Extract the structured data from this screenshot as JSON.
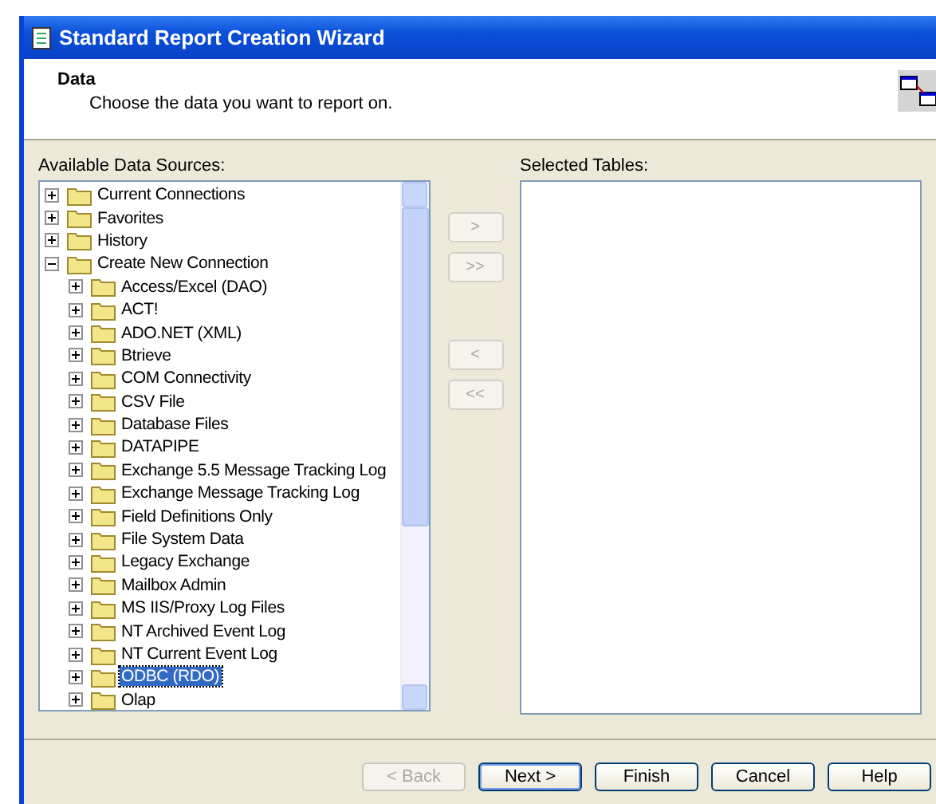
{
  "window": {
    "title": "Standard Report Creation Wizard"
  },
  "header": {
    "title": "Data",
    "subtitle": "Choose the data you want to report on."
  },
  "available": {
    "label": "Available Data Sources:",
    "items": [
      {
        "label": "Current Connections",
        "expanded": false,
        "selected": false
      },
      {
        "label": "Favorites",
        "expanded": false,
        "selected": false
      },
      {
        "label": "History",
        "expanded": false,
        "selected": false
      },
      {
        "label": "Create New Connection",
        "expanded": true,
        "selected": false,
        "children": [
          {
            "label": "Access/Excel (DAO)",
            "expanded": false,
            "selected": false
          },
          {
            "label": "ACT!",
            "expanded": false,
            "selected": false
          },
          {
            "label": "ADO.NET (XML)",
            "expanded": false,
            "selected": false
          },
          {
            "label": "Btrieve",
            "expanded": false,
            "selected": false
          },
          {
            "label": "COM Connectivity",
            "expanded": false,
            "selected": false
          },
          {
            "label": "CSV File",
            "expanded": false,
            "selected": false
          },
          {
            "label": "Database Files",
            "expanded": false,
            "selected": false
          },
          {
            "label": "DATAPIPE",
            "expanded": false,
            "selected": false
          },
          {
            "label": "Exchange 5.5 Message Tracking Log",
            "expanded": false,
            "selected": false
          },
          {
            "label": "Exchange Message Tracking Log",
            "expanded": false,
            "selected": false
          },
          {
            "label": "Field Definitions Only",
            "expanded": false,
            "selected": false
          },
          {
            "label": "File System Data",
            "expanded": false,
            "selected": false
          },
          {
            "label": "Legacy Exchange",
            "expanded": false,
            "selected": false
          },
          {
            "label": "Mailbox Admin",
            "expanded": false,
            "selected": false
          },
          {
            "label": "MS IIS/Proxy Log Files",
            "expanded": false,
            "selected": false
          },
          {
            "label": "NT Archived Event Log",
            "expanded": false,
            "selected": false
          },
          {
            "label": "NT Current Event Log",
            "expanded": false,
            "selected": false
          },
          {
            "label": "ODBC (RDO)",
            "expanded": false,
            "selected": true
          },
          {
            "label": "Olap",
            "expanded": false,
            "selected": false
          }
        ]
      }
    ]
  },
  "move_buttons": [
    {
      "label": ">",
      "disabled": true
    },
    {
      "label": ">>",
      "disabled": true
    },
    {
      "label": "<",
      "disabled": true
    },
    {
      "label": "<<",
      "disabled": true
    }
  ],
  "selected_tables": {
    "label": "Selected Tables:"
  },
  "buttons": [
    {
      "label": "< Back",
      "disabled": true,
      "default": false
    },
    {
      "label": "Next >",
      "disabled": false,
      "default": true
    },
    {
      "label": "Finish",
      "disabled": false,
      "default": false
    },
    {
      "label": "Cancel",
      "disabled": false,
      "default": false
    },
    {
      "label": "Help",
      "disabled": false,
      "default": false
    }
  ]
}
